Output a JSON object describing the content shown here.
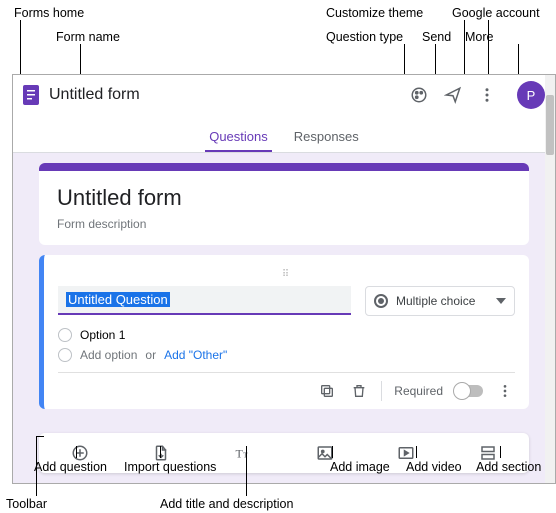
{
  "callouts": {
    "forms_home": "Forms home",
    "form_name": "Form name",
    "customize_theme": "Customize theme",
    "question_type": "Question type",
    "send": "Send",
    "google_account": "Google account",
    "more": "More",
    "add_question": "Add question",
    "import_questions": "Import questions",
    "add_title_desc": "Add title and description",
    "add_image": "Add image",
    "add_video": "Add video",
    "add_section": "Add section",
    "toolbar": "Toolbar"
  },
  "header": {
    "title": "Untitled form",
    "avatar_initial": "P"
  },
  "tabs": {
    "questions": "Questions",
    "responses": "Responses"
  },
  "title_card": {
    "title": "Untitled form",
    "description": "Form description"
  },
  "question": {
    "text": "Untitled Question",
    "type_label": "Multiple choice",
    "option1": "Option 1",
    "add_option": "Add option",
    "or": "or",
    "add_other": "Add \"Other\"",
    "required": "Required"
  }
}
